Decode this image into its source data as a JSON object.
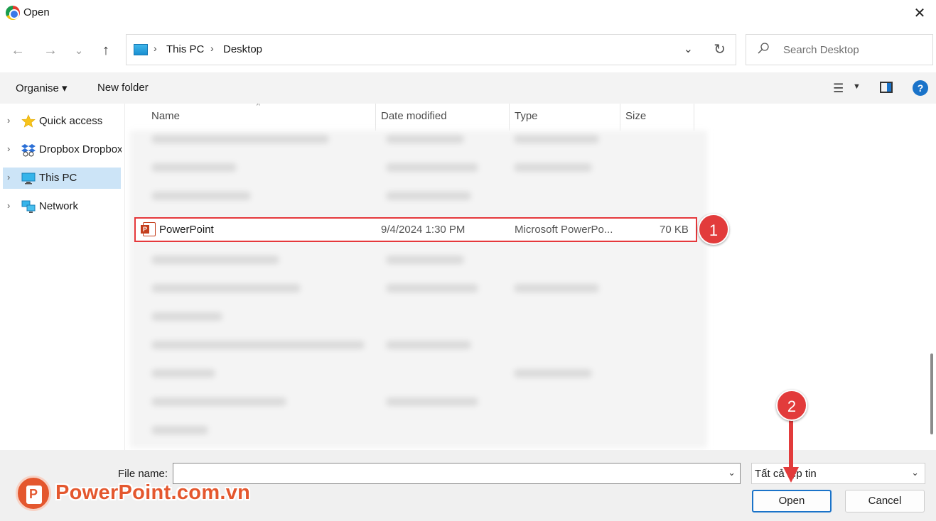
{
  "window": {
    "title": "Open",
    "close_glyph": "✕"
  },
  "nav": {
    "back_glyph": "←",
    "forward_glyph": "→",
    "recent_glyph": "⌄",
    "up_glyph": "↑",
    "breadcrumbs": [
      "This PC",
      "Desktop"
    ],
    "crumb_sep": "›",
    "dropdown_glyph": "⌄",
    "refresh_glyph": "↻",
    "search_placeholder": "Search Desktop"
  },
  "toolbar": {
    "organise_label": "Organise ▾",
    "new_folder_label": "New folder",
    "view_glyph": "☰",
    "view_dd_glyph": "▼",
    "help_glyph": "?"
  },
  "sidebar": {
    "items": [
      {
        "label": "Quick access",
        "icon": "star-icon"
      },
      {
        "label": "Dropbox Dropbox",
        "icon": "dropbox-icon"
      },
      {
        "label": "This PC",
        "icon": "computer-icon",
        "selected": true
      },
      {
        "label": "Network",
        "icon": "network-icon"
      }
    ],
    "chevron_glyph": "›"
  },
  "columns": {
    "name": "Name",
    "date": "Date modified",
    "type": "Type",
    "size": "Size",
    "sort_glyph": "^"
  },
  "file": {
    "name": "PowerPoint",
    "date": "9/4/2024 1:30 PM",
    "type": "Microsoft PowerPo...",
    "size": "70 KB"
  },
  "badges": {
    "one": "1",
    "two": "2"
  },
  "bottom": {
    "file_name_label": "File name:",
    "file_name_value": "",
    "file_type_value": "Tất cả tệp tin",
    "open_label": "Open",
    "cancel_label": "Cancel",
    "dd_glyph": "⌄"
  },
  "watermark": {
    "text": "PowerPoint.com.vn"
  },
  "colors": {
    "accent": "#1a73c9",
    "highlight": "#e5383b",
    "selected": "#cce4f7",
    "brand": "#e4572e"
  }
}
